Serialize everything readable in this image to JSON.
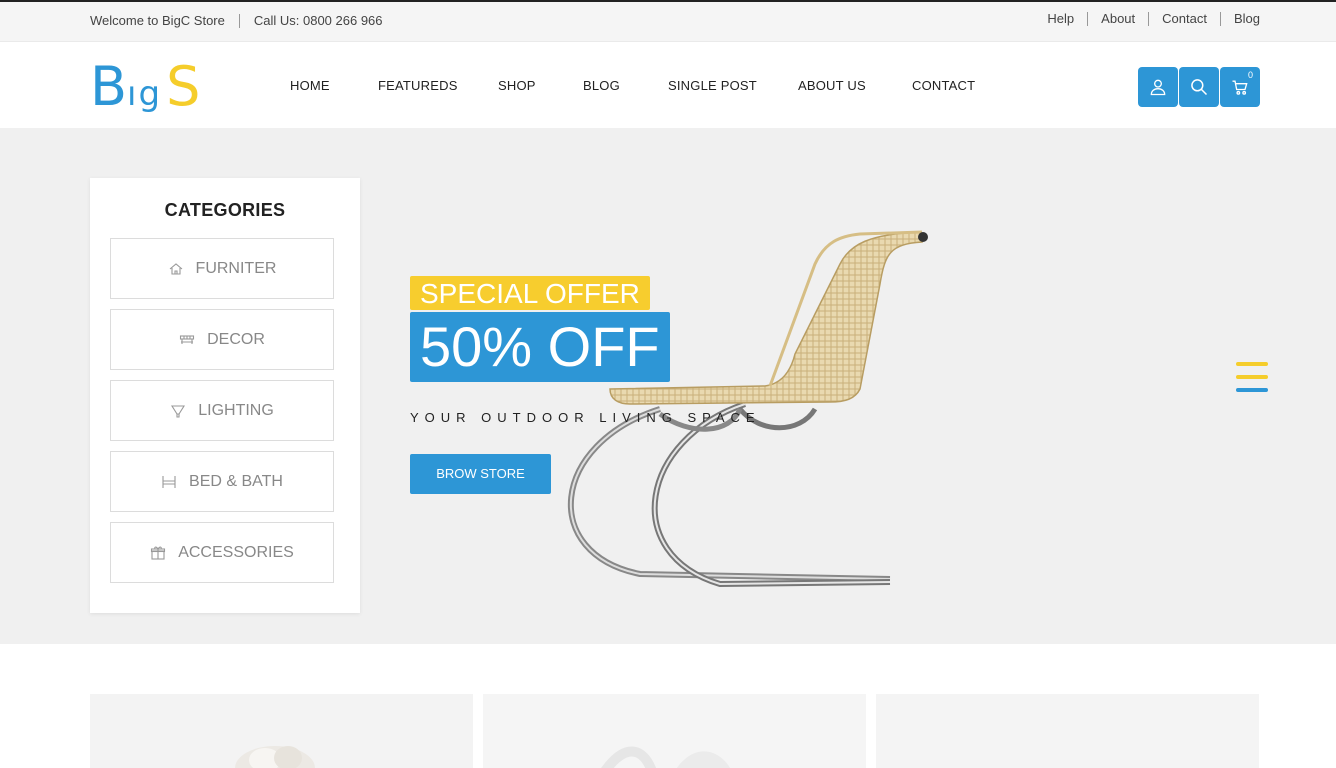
{
  "topbar": {
    "welcome": "Welcome to BigC Store",
    "phone": "Call Us: 0800 266 966",
    "links": [
      "Help",
      "About",
      "Contact",
      "Blog"
    ]
  },
  "brand": {
    "logo_b": "B",
    "logo_ig": "ıg",
    "logo_s": "S",
    "primary_color": "#2d96d6",
    "accent_color": "#f5cd2b"
  },
  "nav": {
    "items": [
      "HOME",
      "FEATUREDS",
      "SHOP",
      "BLOG",
      "SINGLE POST",
      "ABOUT US",
      "CONTACT"
    ]
  },
  "header_icons": {
    "account": "user-icon",
    "search": "search-icon",
    "cart": "cart-icon",
    "cart_count": "0"
  },
  "categories": {
    "title": "CATEGORIES",
    "items": [
      {
        "label": "FURNITER",
        "icon": "home-icon"
      },
      {
        "label": "DECOR",
        "icon": "bench-icon"
      },
      {
        "label": "LIGHTING",
        "icon": "lamp-icon"
      },
      {
        "label": "BED & BATH",
        "icon": "bed-icon"
      },
      {
        "label": "ACCESSORIES",
        "icon": "gift-icon"
      }
    ]
  },
  "hero": {
    "tag": "SPECIAL OFFER",
    "headline": "50% OFF",
    "tagline": "YOUR OUTDOOR LIVING SPACE",
    "button": "BROW STORE"
  }
}
